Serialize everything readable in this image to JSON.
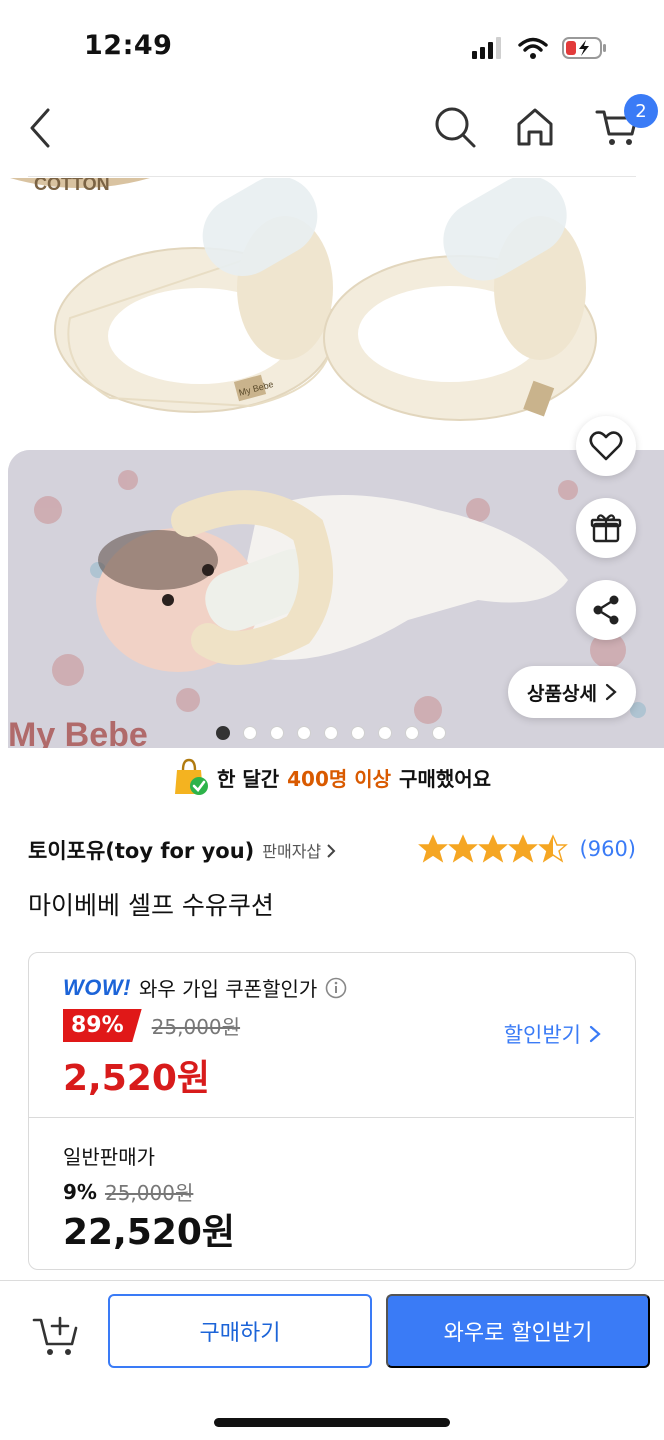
{
  "status_bar": {
    "time": "12:49"
  },
  "nav": {
    "cart_count": "2"
  },
  "image": {
    "label_top": "COTTON",
    "brand_tag": "My Bebe",
    "brand_watermark": "My Bebe",
    "detail_label": "상품상세",
    "dots_total": 9,
    "dots_active": 0
  },
  "promo": {
    "prefix": "한 달간",
    "highlight": "400명 이상",
    "suffix": "구매했어요"
  },
  "seller": {
    "name": "토이포유(toy for you)",
    "shop_link": "판매자샵",
    "rating": 4.5,
    "rating_count": "(960)"
  },
  "product": {
    "title": "마이베베 셀프 수유쿠션"
  },
  "wow_price": {
    "logo": "WOW!",
    "label": "와우 가입 쿠폰할인가",
    "discount": "89%",
    "original": "25,000원",
    "price": "2,520원",
    "coupon_link": "할인받기"
  },
  "normal_price": {
    "label": "일반판매가",
    "discount": "9%",
    "original": "25,000원",
    "price": "22,520원"
  },
  "actions": {
    "buy": "구매하기",
    "wow": "와우로 할인받기"
  },
  "colors": {
    "accent_blue": "#3a7bf6",
    "discount_red": "#e01818",
    "price_red": "#d81b1b",
    "promo_orange": "#d95a00",
    "star": "#f5a623"
  }
}
